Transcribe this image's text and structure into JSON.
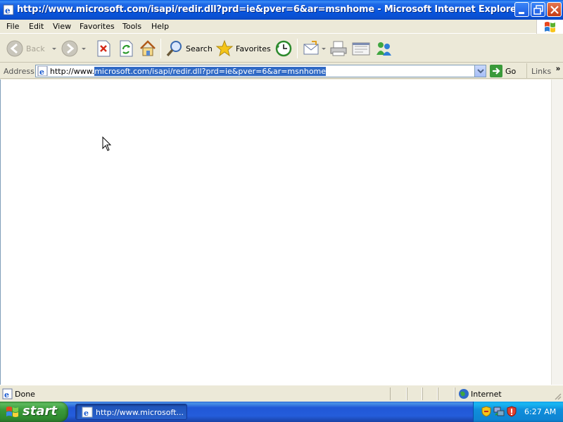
{
  "window": {
    "title": "http://www.microsoft.com/isapi/redir.dll?prd=ie&pver=6&ar=msnhome - Microsoft Internet Explorer",
    "title_color": "#0A5FE6"
  },
  "menu": {
    "items": [
      "File",
      "Edit",
      "View",
      "Favorites",
      "Tools",
      "Help"
    ]
  },
  "toolbar": {
    "back_label": "Back",
    "search_label": "Search",
    "favorites_label": "Favorites"
  },
  "address": {
    "label": "Address",
    "url_prefix": "http://www.",
    "url_selected": "microsoft.com/isapi/redir.dll?prd=ie&pver=6&ar=msnhome",
    "go_label": "Go",
    "links_label": "Links",
    "links_chevron": "»"
  },
  "status": {
    "text": "Done",
    "zone": "Internet"
  },
  "taskbar": {
    "start_label": "start",
    "task_label": "http://www.microsoft...",
    "clock": "6:27 AM"
  },
  "colors": {
    "selection": "#316AC5",
    "taskbar_blue": "#245DDB",
    "start_green": "#3A9A3A"
  }
}
